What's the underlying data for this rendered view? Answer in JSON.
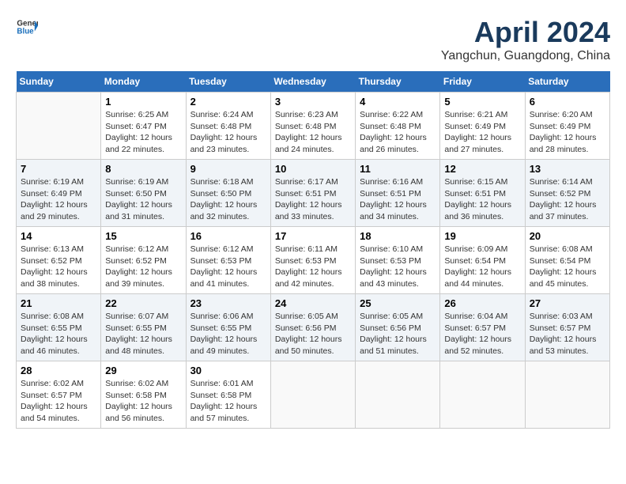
{
  "header": {
    "logo_general": "General",
    "logo_blue": "Blue",
    "month_title": "April 2024",
    "location": "Yangchun, Guangdong, China"
  },
  "weekdays": [
    "Sunday",
    "Monday",
    "Tuesday",
    "Wednesday",
    "Thursday",
    "Friday",
    "Saturday"
  ],
  "weeks": [
    [
      {
        "day": "",
        "sunrise": "",
        "sunset": "",
        "daylight": ""
      },
      {
        "day": "1",
        "sunrise": "Sunrise: 6:25 AM",
        "sunset": "Sunset: 6:47 PM",
        "daylight": "Daylight: 12 hours and 22 minutes."
      },
      {
        "day": "2",
        "sunrise": "Sunrise: 6:24 AM",
        "sunset": "Sunset: 6:48 PM",
        "daylight": "Daylight: 12 hours and 23 minutes."
      },
      {
        "day": "3",
        "sunrise": "Sunrise: 6:23 AM",
        "sunset": "Sunset: 6:48 PM",
        "daylight": "Daylight: 12 hours and 24 minutes."
      },
      {
        "day": "4",
        "sunrise": "Sunrise: 6:22 AM",
        "sunset": "Sunset: 6:48 PM",
        "daylight": "Daylight: 12 hours and 26 minutes."
      },
      {
        "day": "5",
        "sunrise": "Sunrise: 6:21 AM",
        "sunset": "Sunset: 6:49 PM",
        "daylight": "Daylight: 12 hours and 27 minutes."
      },
      {
        "day": "6",
        "sunrise": "Sunrise: 6:20 AM",
        "sunset": "Sunset: 6:49 PM",
        "daylight": "Daylight: 12 hours and 28 minutes."
      }
    ],
    [
      {
        "day": "7",
        "sunrise": "Sunrise: 6:19 AM",
        "sunset": "Sunset: 6:49 PM",
        "daylight": "Daylight: 12 hours and 29 minutes."
      },
      {
        "day": "8",
        "sunrise": "Sunrise: 6:19 AM",
        "sunset": "Sunset: 6:50 PM",
        "daylight": "Daylight: 12 hours and 31 minutes."
      },
      {
        "day": "9",
        "sunrise": "Sunrise: 6:18 AM",
        "sunset": "Sunset: 6:50 PM",
        "daylight": "Daylight: 12 hours and 32 minutes."
      },
      {
        "day": "10",
        "sunrise": "Sunrise: 6:17 AM",
        "sunset": "Sunset: 6:51 PM",
        "daylight": "Daylight: 12 hours and 33 minutes."
      },
      {
        "day": "11",
        "sunrise": "Sunrise: 6:16 AM",
        "sunset": "Sunset: 6:51 PM",
        "daylight": "Daylight: 12 hours and 34 minutes."
      },
      {
        "day": "12",
        "sunrise": "Sunrise: 6:15 AM",
        "sunset": "Sunset: 6:51 PM",
        "daylight": "Daylight: 12 hours and 36 minutes."
      },
      {
        "day": "13",
        "sunrise": "Sunrise: 6:14 AM",
        "sunset": "Sunset: 6:52 PM",
        "daylight": "Daylight: 12 hours and 37 minutes."
      }
    ],
    [
      {
        "day": "14",
        "sunrise": "Sunrise: 6:13 AM",
        "sunset": "Sunset: 6:52 PM",
        "daylight": "Daylight: 12 hours and 38 minutes."
      },
      {
        "day": "15",
        "sunrise": "Sunrise: 6:12 AM",
        "sunset": "Sunset: 6:52 PM",
        "daylight": "Daylight: 12 hours and 39 minutes."
      },
      {
        "day": "16",
        "sunrise": "Sunrise: 6:12 AM",
        "sunset": "Sunset: 6:53 PM",
        "daylight": "Daylight: 12 hours and 41 minutes."
      },
      {
        "day": "17",
        "sunrise": "Sunrise: 6:11 AM",
        "sunset": "Sunset: 6:53 PM",
        "daylight": "Daylight: 12 hours and 42 minutes."
      },
      {
        "day": "18",
        "sunrise": "Sunrise: 6:10 AM",
        "sunset": "Sunset: 6:53 PM",
        "daylight": "Daylight: 12 hours and 43 minutes."
      },
      {
        "day": "19",
        "sunrise": "Sunrise: 6:09 AM",
        "sunset": "Sunset: 6:54 PM",
        "daylight": "Daylight: 12 hours and 44 minutes."
      },
      {
        "day": "20",
        "sunrise": "Sunrise: 6:08 AM",
        "sunset": "Sunset: 6:54 PM",
        "daylight": "Daylight: 12 hours and 45 minutes."
      }
    ],
    [
      {
        "day": "21",
        "sunrise": "Sunrise: 6:08 AM",
        "sunset": "Sunset: 6:55 PM",
        "daylight": "Daylight: 12 hours and 46 minutes."
      },
      {
        "day": "22",
        "sunrise": "Sunrise: 6:07 AM",
        "sunset": "Sunset: 6:55 PM",
        "daylight": "Daylight: 12 hours and 48 minutes."
      },
      {
        "day": "23",
        "sunrise": "Sunrise: 6:06 AM",
        "sunset": "Sunset: 6:55 PM",
        "daylight": "Daylight: 12 hours and 49 minutes."
      },
      {
        "day": "24",
        "sunrise": "Sunrise: 6:05 AM",
        "sunset": "Sunset: 6:56 PM",
        "daylight": "Daylight: 12 hours and 50 minutes."
      },
      {
        "day": "25",
        "sunrise": "Sunrise: 6:05 AM",
        "sunset": "Sunset: 6:56 PM",
        "daylight": "Daylight: 12 hours and 51 minutes."
      },
      {
        "day": "26",
        "sunrise": "Sunrise: 6:04 AM",
        "sunset": "Sunset: 6:57 PM",
        "daylight": "Daylight: 12 hours and 52 minutes."
      },
      {
        "day": "27",
        "sunrise": "Sunrise: 6:03 AM",
        "sunset": "Sunset: 6:57 PM",
        "daylight": "Daylight: 12 hours and 53 minutes."
      }
    ],
    [
      {
        "day": "28",
        "sunrise": "Sunrise: 6:02 AM",
        "sunset": "Sunset: 6:57 PM",
        "daylight": "Daylight: 12 hours and 54 minutes."
      },
      {
        "day": "29",
        "sunrise": "Sunrise: 6:02 AM",
        "sunset": "Sunset: 6:58 PM",
        "daylight": "Daylight: 12 hours and 56 minutes."
      },
      {
        "day": "30",
        "sunrise": "Sunrise: 6:01 AM",
        "sunset": "Sunset: 6:58 PM",
        "daylight": "Daylight: 12 hours and 57 minutes."
      },
      {
        "day": "",
        "sunrise": "",
        "sunset": "",
        "daylight": ""
      },
      {
        "day": "",
        "sunrise": "",
        "sunset": "",
        "daylight": ""
      },
      {
        "day": "",
        "sunrise": "",
        "sunset": "",
        "daylight": ""
      },
      {
        "day": "",
        "sunrise": "",
        "sunset": "",
        "daylight": ""
      }
    ]
  ]
}
